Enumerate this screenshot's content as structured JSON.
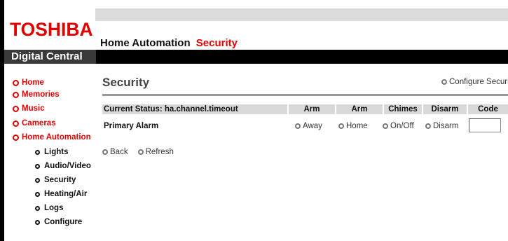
{
  "brand": {
    "logo": "TOSHIBA",
    "subtitle": "Digital Central"
  },
  "header": {
    "section": "Home Automation",
    "subsection": "Security"
  },
  "nav": {
    "main": [
      {
        "label": "Home"
      },
      {
        "label": "Memories"
      },
      {
        "label": "Music"
      },
      {
        "label": "Cameras"
      },
      {
        "label": "Home Automation"
      }
    ],
    "sub": [
      {
        "label": "Lights"
      },
      {
        "label": "Audio/Video"
      },
      {
        "label": "Security"
      },
      {
        "label": "Heating/Air"
      },
      {
        "label": "Logs"
      },
      {
        "label": "Configure"
      }
    ]
  },
  "page": {
    "title": "Security",
    "configure_link": "Configure Security"
  },
  "table": {
    "status_header": "Current Status: ha.channel.timeout",
    "columns": [
      "Arm",
      "Arm",
      "Chimes",
      "Disarm",
      "Code"
    ],
    "rows": [
      {
        "label": "Primary Alarm",
        "away": "Away",
        "home": "Home",
        "chimes": "On/Off",
        "disarm": "Disarm",
        "code_value": ""
      }
    ]
  },
  "actions": {
    "back": "Back",
    "refresh": "Refresh"
  },
  "colors": {
    "brand_red": "#e00000",
    "bar_black": "#000000",
    "header_grey": "#d9d9d9"
  }
}
